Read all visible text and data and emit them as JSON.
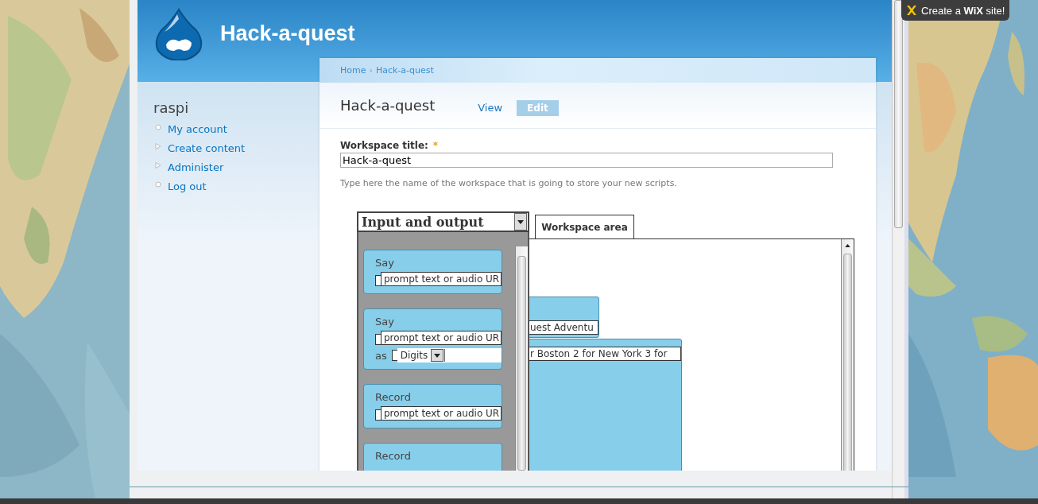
{
  "site": {
    "name": "Hack-a-quest"
  },
  "breadcrumb": {
    "items": [
      "Home",
      "Hack-a-quest"
    ],
    "separator": "›"
  },
  "user": {
    "name": "raspi",
    "menu": [
      {
        "label": "My account",
        "kind": "leaf"
      },
      {
        "label": "Create content",
        "kind": "collapsed"
      },
      {
        "label": "Administer",
        "kind": "collapsed"
      },
      {
        "label": "Log out",
        "kind": "leaf"
      }
    ]
  },
  "page": {
    "title": "Hack-a-quest",
    "tabs": [
      {
        "label": "View",
        "selected": false
      },
      {
        "label": "Edit",
        "selected": true
      }
    ]
  },
  "form": {
    "label": "Workspace title:",
    "required_mark": "*",
    "value": "Hack-a-quest",
    "description": "Type here the name of the workspace that is going to store your new scripts."
  },
  "editor": {
    "category": "Input and output",
    "workspace_tab": "Workspace area",
    "toolbox_blocks": [
      {
        "title": "Say",
        "inputs": [
          {
            "kind": "text",
            "value": "prompt text or audio UR"
          }
        ]
      },
      {
        "title": "Say",
        "inputs": [
          {
            "kind": "text",
            "value": "prompt text or audio UR"
          },
          {
            "kind": "select",
            "label": "as",
            "value": "Digits"
          }
        ]
      },
      {
        "title": "Record",
        "inputs": [
          {
            "kind": "text",
            "value": "prompt text or audio UR"
          }
        ]
      },
      {
        "title": "Record"
      }
    ],
    "workspace_blocks": [
      {
        "value": "uest Adventu"
      },
      {
        "value": "r Boston 2 for New York 3 for"
      }
    ]
  },
  "badge": {
    "text": "Create a **WiX** site!"
  }
}
